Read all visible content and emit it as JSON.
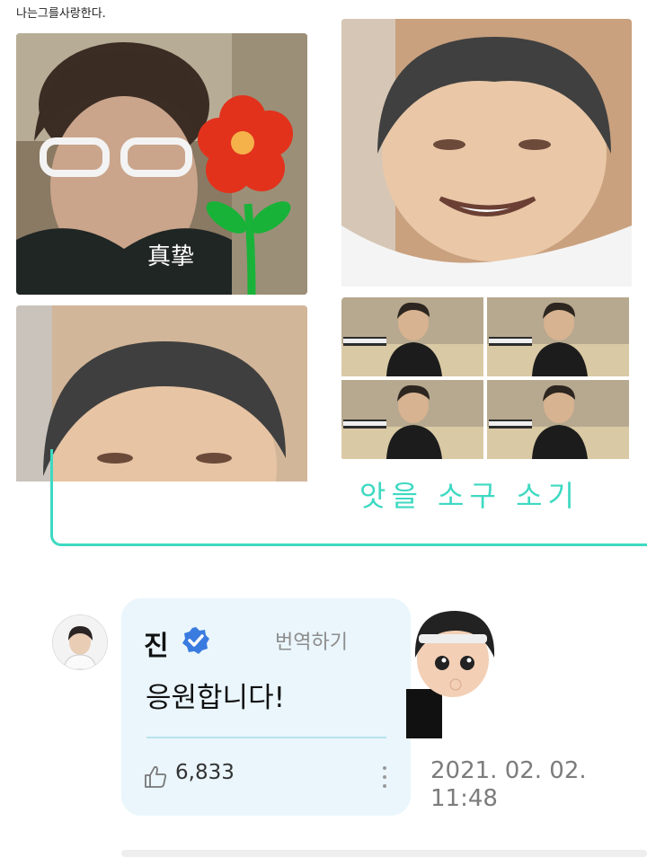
{
  "header": {
    "caption": "나는그를사랑한다."
  },
  "images": [
    {
      "name": "man-glasses-flower-photo",
      "caption": "真挚"
    },
    {
      "name": "round-face-meme-top"
    },
    {
      "name": "round-face-meme-bottom"
    },
    {
      "name": "video-grid-photo"
    }
  ],
  "teal_box": {
    "partial_text": "앗을 소구 소기"
  },
  "comment": {
    "author": "진",
    "verified_icon": "verified-check-icon",
    "translate_label": "번역하기",
    "message": "응원합니다!",
    "like_icon": "thumbs-up-icon",
    "like_count": "6,833",
    "more_icon": "more-vertical-icon",
    "date": "2021. 02. 02.",
    "time": "11:48"
  },
  "colors": {
    "teal": "#3ed9c2",
    "card_bg": "#eaf6fc",
    "verified": "#3a7be0"
  }
}
